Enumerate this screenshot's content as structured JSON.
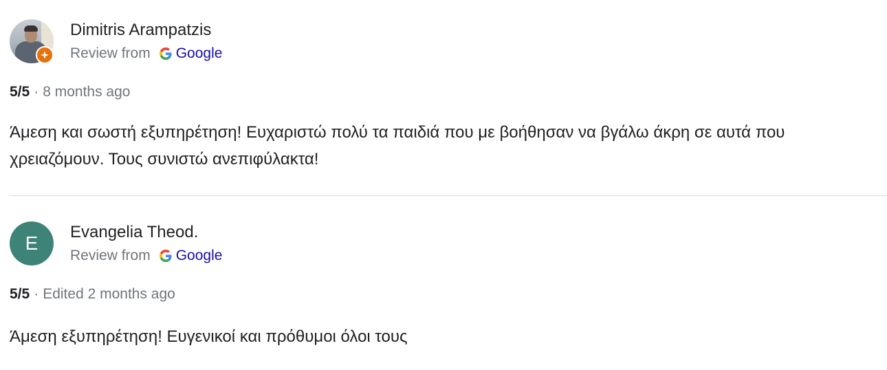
{
  "reviews": [
    {
      "author": "Dimitris Arampatzis",
      "review_from": "Review from",
      "source": "Google",
      "rating": "5/5",
      "separator": "·",
      "time": "8 months ago",
      "text": "Άμεση και σωστή εξυπηρέτηση! Ευχαριστώ πολύ τα παιδιά που με βοήθησαν να βγάλω άκρη σε αυτά που χρειαζόμουν. Τους συνιστώ ανεπιφύλακτα!"
    },
    {
      "author": "Evangelia Theod.",
      "avatar_letter": "E",
      "avatar_color": "#3e8377",
      "review_from": "Review from",
      "source": "Google",
      "rating": "5/5",
      "separator": "·",
      "time": "Edited 2 months ago",
      "text": "Άμεση εξυπηρέτηση! Ευγενικοί και πρόθυμοι όλοι τους"
    }
  ],
  "icons": {
    "local_guide_badge": "local-guide-badge-icon",
    "google_logo": "google-g-logo-icon"
  },
  "colors": {
    "link": "#1a0dab",
    "badge": "#e8710a",
    "secondary_text": "#70757a"
  }
}
